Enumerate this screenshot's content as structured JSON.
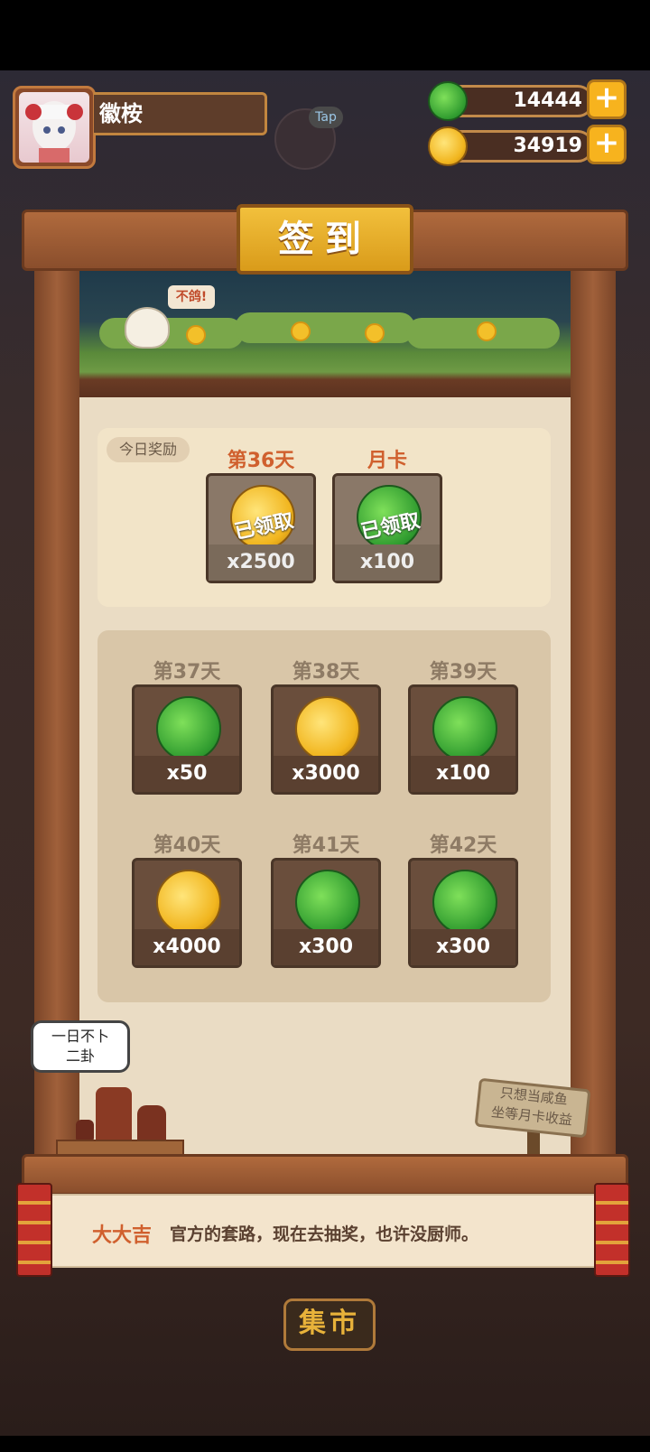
{
  "player": {
    "name": "徽桉"
  },
  "hud": {
    "tap_label": "Tap",
    "jade_amount": "14444",
    "coin_amount": "34919",
    "plus_symbol": "+"
  },
  "signin": {
    "title": "签到",
    "bird_bubble": "不鸽!",
    "today_tag": "今日奖励",
    "today": [
      {
        "label": "第36天",
        "reward": "coin",
        "qty": "x2500",
        "status": "已领取"
      },
      {
        "label": "月卡",
        "reward": "jade",
        "qty": "x100",
        "status": "已领取"
      }
    ],
    "upcoming": [
      {
        "label": "第37天",
        "reward": "jade",
        "qty": "x50"
      },
      {
        "label": "第38天",
        "reward": "coin",
        "qty": "x3000"
      },
      {
        "label": "第39天",
        "reward": "jade",
        "qty": "x100"
      },
      {
        "label": "第40天",
        "reward": "coin",
        "qty": "x4000"
      },
      {
        "label": "第41天",
        "reward": "jade",
        "qty": "x300"
      },
      {
        "label": "第42天",
        "reward": "jade",
        "qty": "x300"
      }
    ]
  },
  "decor": {
    "speech_line1": "一日不卜",
    "speech_line2": "二卦",
    "sign_line1": "只想当咸鱼",
    "sign_line2": "坐等月卡收益"
  },
  "tip": {
    "speaker": "大大吉",
    "text": "官方的套路，现在去抽奖，也许没厨师。"
  },
  "bottom": {
    "market_label": "集市"
  },
  "colors": {
    "jade": "#2f9b2f",
    "coin": "#f1b51e",
    "accent": "#d0602e",
    "wood": "#8a4e2c"
  }
}
